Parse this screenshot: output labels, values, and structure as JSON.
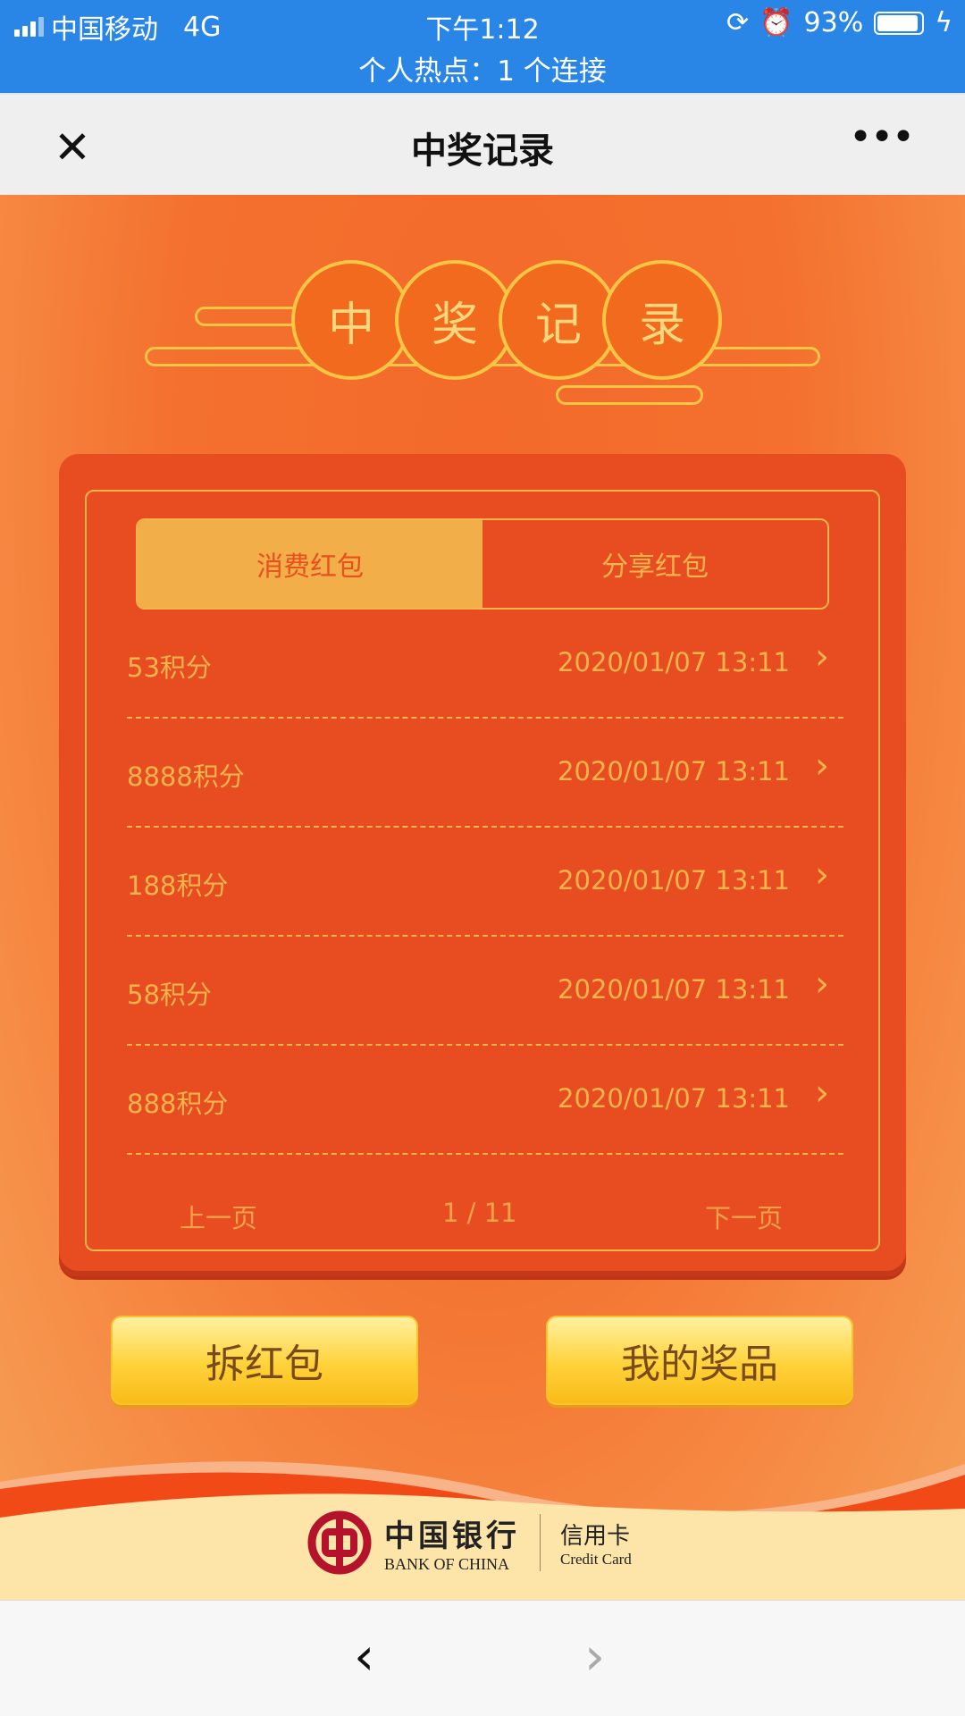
{
  "status_bar": {
    "carrier": "中国移动",
    "network": "4G",
    "time": "下午1:12",
    "battery": "93%",
    "battery_level": 0.93,
    "hotspot": "个人热点：1 个连接"
  },
  "nav": {
    "title": "中奖记录",
    "close_icon": "close-icon",
    "more_icon": "more-icon"
  },
  "heading": {
    "chars": [
      "中",
      "奖",
      "记",
      "录"
    ]
  },
  "tabs": [
    {
      "label": "消费红包",
      "active": true
    },
    {
      "label": "分享红包",
      "active": false
    }
  ],
  "records": [
    {
      "points": "53积分",
      "date": "2020/01/07 13:11"
    },
    {
      "points": "8888积分",
      "date": "2020/01/07 13:11"
    },
    {
      "points": "188积分",
      "date": "2020/01/07 13:11"
    },
    {
      "points": "58积分",
      "date": "2020/01/07 13:11"
    },
    {
      "points": "888积分",
      "date": "2020/01/07 13:11"
    }
  ],
  "pagination": {
    "prev": "上一页",
    "current": "1 /  11",
    "next": "下一页"
  },
  "buttons": {
    "open": "拆红包",
    "prizes": "我的奖品"
  },
  "footer": {
    "bank_cn": "中国银行",
    "bank_en": "BANK OF CHINA",
    "product_cn": "信用卡",
    "product_en": "Credit Card"
  },
  "colors": {
    "status_bar": "#2a86e6",
    "card": "#e84d22",
    "gold": "#f7b44b",
    "bank_red": "#b5122c"
  }
}
